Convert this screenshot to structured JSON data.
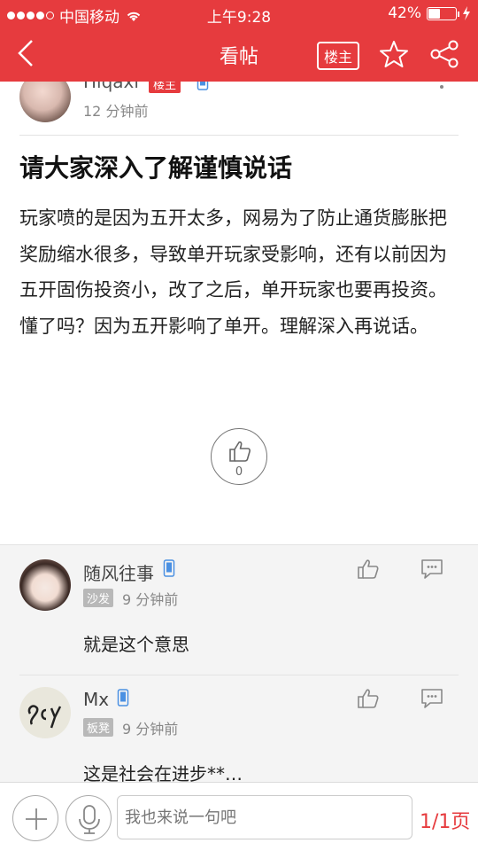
{
  "status_bar": {
    "carrier": "中国移动",
    "time": "上午9:28",
    "battery": "42%"
  },
  "nav": {
    "title": "看帖",
    "op_only_label": "楼主",
    "icons": [
      "back-icon",
      "star-icon",
      "share-icon"
    ]
  },
  "post": {
    "author": {
      "name": "Hiqaxi",
      "badge": "楼主",
      "time": "12 分钟前"
    },
    "title": "请大家深入了解谨慎说话",
    "body": "玩家喷的是因为五开太多，网易为了防止通货膨胀把奖励缩水很多，导致单开玩家受影响，还有以前因为五开固伤投资小，改了之后，单开玩家也要再投资。懂了吗？因为五开影响了单开。理解深入再说话。",
    "like_count": "0"
  },
  "comments": [
    {
      "name": "随风往事",
      "badge": "沙发",
      "time": "9 分钟前",
      "text": "就是这个意思"
    },
    {
      "name": "Mx",
      "badge": "板凳",
      "time": "9 分钟前",
      "text": "这是社会在进步**…"
    }
  ],
  "bottom_bar": {
    "input_placeholder": "我也来说一句吧",
    "page_indicator": "1/1页"
  },
  "colors": {
    "accent": "#e63b3e",
    "comment_bg": "#f4f4f4"
  }
}
